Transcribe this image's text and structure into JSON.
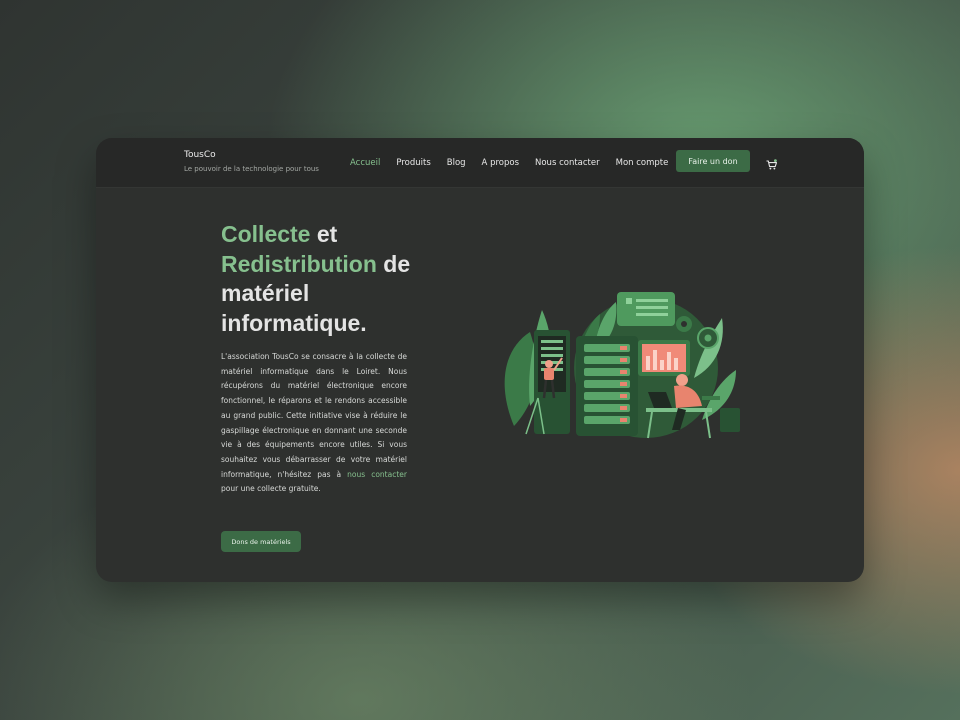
{
  "header": {
    "brand_name": "TousCo",
    "brand_tagline": "Le pouvoir de la technologie pour tous",
    "nav": [
      {
        "label": "Accueil",
        "active": true
      },
      {
        "label": "Produits",
        "active": false
      },
      {
        "label": "Blog",
        "active": false
      },
      {
        "label": "A propos",
        "active": false
      },
      {
        "label": "Nous contacter",
        "active": false
      },
      {
        "label": "Mon compte",
        "active": false
      }
    ],
    "donate_label": "Faire un don",
    "cart_icon": "cart-icon"
  },
  "hero": {
    "title": {
      "w1": "Collecte",
      "w2": "et",
      "w3": "Redistribution",
      "w4": "de",
      "w5": "matériel",
      "w6": "informatique."
    },
    "paragraph_before": "L'association TousCo se consacre à la collecte de matériel informatique dans le Loiret. Nous récupérons du matériel électronique encore fonctionnel, le réparons et le rendons accessible au grand public. Cette initiative vise à réduire le gaspillage électronique en donnant une seconde vie à des équipements encore utiles. Si vous souhaitez vous débarrasser de votre matériel informatique, n'hésitez pas à",
    "contact_link": "nous contacter",
    "paragraph_after": "pour une collecte gratuite.",
    "cta_label": "Dons de matériels"
  },
  "theme": {
    "accent": "#86c08e",
    "button_bg": "#3c6b46",
    "window_bg": "#2e302e",
    "header_bg": "#272827"
  },
  "illustration": {
    "icon": "server-room-illustration"
  }
}
